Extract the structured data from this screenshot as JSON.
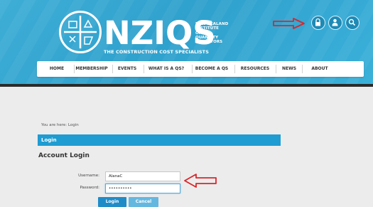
{
  "logo": {
    "acronym": "NZIQS",
    "tagline": "THE CONSTRUCTION COST SPECIALISTS",
    "institute_lines": [
      "NEW ZEALAND",
      "INSTITUTE",
      "OF",
      "QUANTITY",
      "SURVEYORS"
    ]
  },
  "header_icons": [
    "lock-icon",
    "user-icon",
    "search-icon"
  ],
  "nav": {
    "items": [
      "HOME",
      "MEMBERSHIP",
      "EVENTS",
      "WHAT IS A QS?",
      "BECOME A QS",
      "RESOURCES",
      "NEWS",
      "ABOUT"
    ]
  },
  "breadcrumb": {
    "text": "You are here: Login"
  },
  "login": {
    "title_bar": "Login",
    "heading": "Account Login",
    "username_label": "Username:",
    "username_value": "AlanaC",
    "password_label": "Password:",
    "password_value": "••••••••••",
    "login_button": "Login",
    "cancel_button": "Cancel"
  },
  "colors": {
    "header_blue": "#2fa1cd",
    "title_bar_blue": "#1f9cd2",
    "arrow_red": "#d9262b"
  }
}
